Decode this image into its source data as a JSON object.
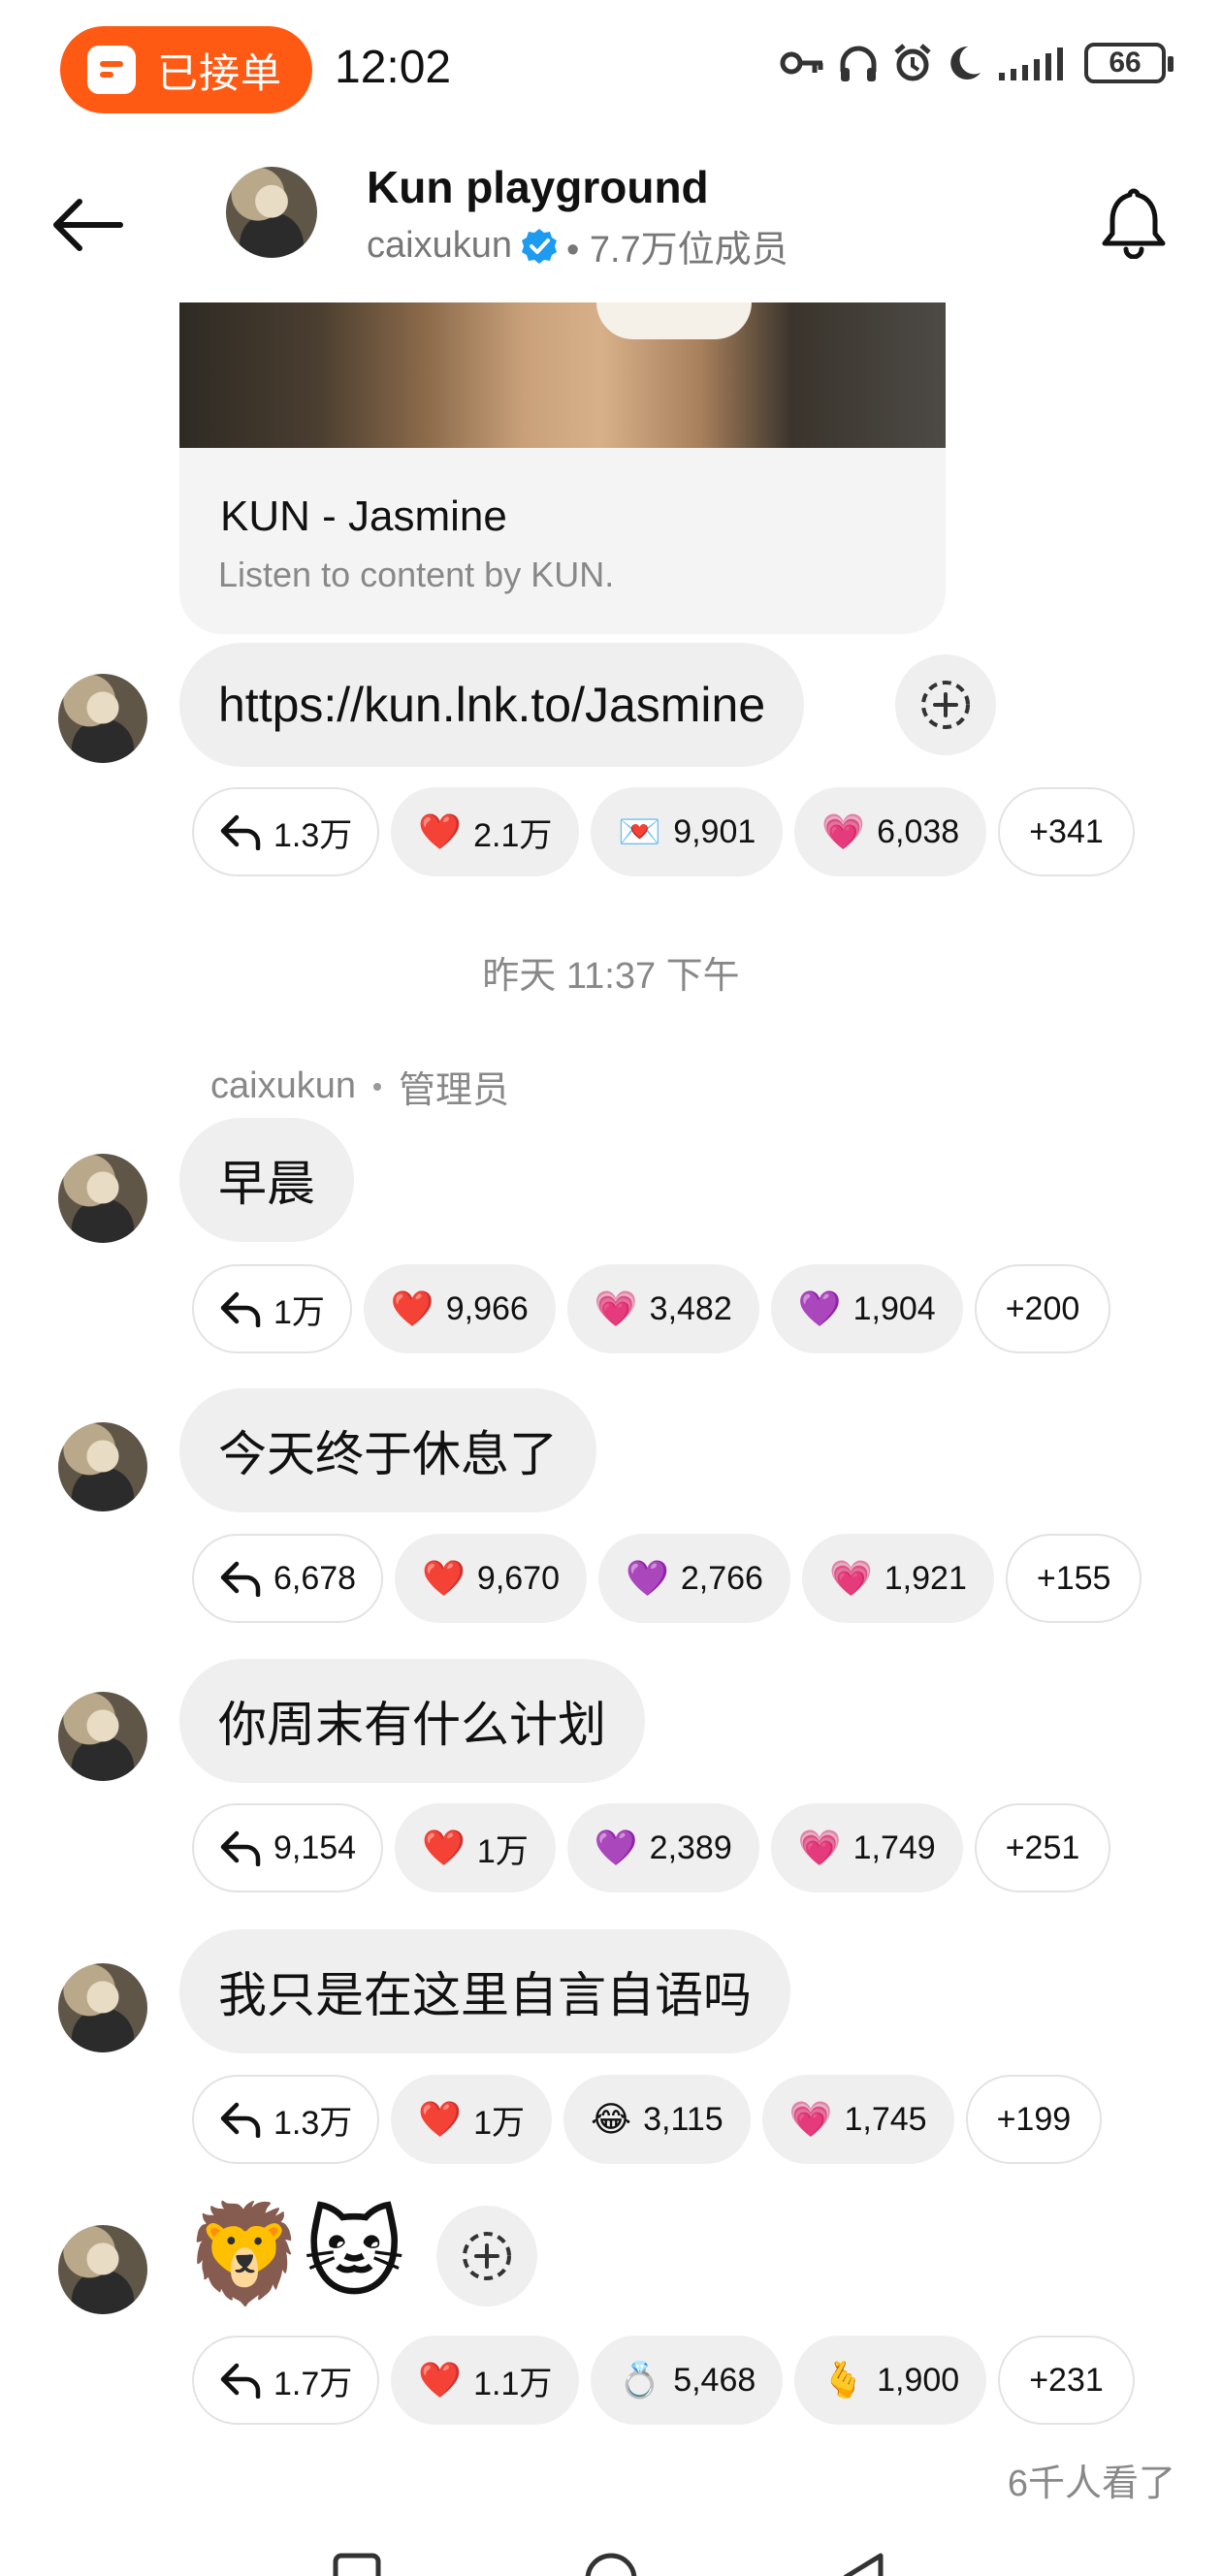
{
  "status_bar": {
    "order_label": "已接单",
    "time": "12:02",
    "battery": "66",
    "icons": [
      "key-icon",
      "headphones-icon",
      "alarm-icon",
      "moon-icon",
      "signal-icon",
      "battery-icon"
    ]
  },
  "header": {
    "title": "Kun playground",
    "handle": "caixukun",
    "members": "• 7.7万位成员"
  },
  "preview": {
    "title": "KUN - Jasmine",
    "description": "Listen to content by KUN."
  },
  "messages": [
    {
      "text": "https://kun.lnk.to/Jasmine",
      "reply_count": "1.3万",
      "reactions": [
        {
          "emoji": "❤️",
          "count": "2.1万"
        },
        {
          "emoji": "💌",
          "count": "9,901"
        },
        {
          "emoji": "💗",
          "count": "6,038"
        }
      ],
      "more": "+341"
    },
    {
      "text": "早晨",
      "reply_count": "1万",
      "reactions": [
        {
          "emoji": "❤️",
          "count": "9,966"
        },
        {
          "emoji": "💗",
          "count": "3,482"
        },
        {
          "emoji": "💜",
          "count": "1,904"
        }
      ],
      "more": "+200"
    },
    {
      "text": "今天终于休息了",
      "reply_count": "6,678",
      "reactions": [
        {
          "emoji": "❤️",
          "count": "9,670"
        },
        {
          "emoji": "💜",
          "count": "2,766"
        },
        {
          "emoji": "💗",
          "count": "1,921"
        }
      ],
      "more": "+155"
    },
    {
      "text": "你周末有什么计划",
      "reply_count": "9,154",
      "reactions": [
        {
          "emoji": "❤️",
          "count": "1万"
        },
        {
          "emoji": "💜",
          "count": "2,389"
        },
        {
          "emoji": "💗",
          "count": "1,749"
        }
      ],
      "more": "+251"
    },
    {
      "text": "我只是在这里自言自语吗",
      "reply_count": "1.3万",
      "reactions": [
        {
          "emoji": "❤️",
          "count": "1万"
        },
        {
          "emoji": "😂",
          "count": "3,115"
        },
        {
          "emoji": "💗",
          "count": "1,745"
        }
      ],
      "more": "+199"
    },
    {
      "emojis": [
        "🦁",
        "🐱"
      ],
      "reply_count": "1.7万",
      "reactions": [
        {
          "emoji": "❤️",
          "count": "1.1万"
        },
        {
          "emoji": "💍",
          "count": "5,468"
        },
        {
          "emoji": "🫰",
          "count": "1,900"
        }
      ],
      "more": "+231"
    }
  ],
  "timestamp": "昨天 11:37 下午",
  "sender": {
    "name": "caixukun",
    "role": "管理员"
  },
  "views": "6千人看了",
  "colors": {
    "accent": "#ff5a14",
    "bubble": "#efefef",
    "verified": "#1d9bf0"
  }
}
